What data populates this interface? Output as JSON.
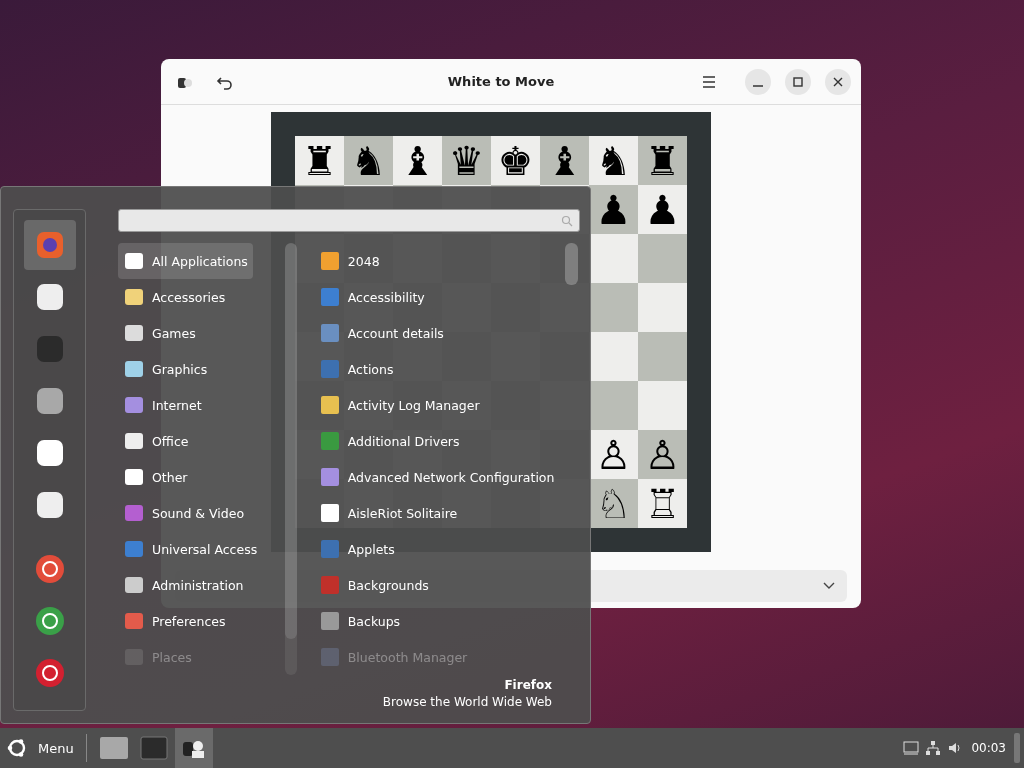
{
  "chess_window": {
    "title": "White to Move",
    "board": [
      [
        {
          "empty": false,
          "piece": "♜"
        },
        {
          "empty": false,
          "piece": "♞"
        },
        {
          "empty": false,
          "piece": "♝"
        },
        {
          "empty": false,
          "piece": "♛"
        },
        {
          "empty": false,
          "piece": "♚"
        },
        {
          "empty": false,
          "piece": "♝"
        },
        {
          "empty": false,
          "piece": "♞"
        },
        {
          "empty": false,
          "piece": "♜"
        }
      ],
      [
        {
          "empty": false,
          "piece": "♟"
        },
        {
          "empty": false,
          "piece": "♟"
        }
      ],
      [
        {
          "empty": true
        },
        {
          "empty": true
        }
      ],
      [
        {
          "empty": true
        },
        {
          "empty": true
        }
      ],
      [
        {
          "empty": true
        },
        {
          "empty": true
        }
      ],
      [
        {
          "empty": true
        },
        {
          "empty": true
        }
      ],
      [
        {
          "empty": false,
          "piece": "♙"
        },
        {
          "empty": false,
          "piece": "♙"
        }
      ],
      [
        {
          "empty": false,
          "piece": "♘"
        },
        {
          "empty": false,
          "piece": "♖"
        }
      ]
    ]
  },
  "menu": {
    "favorites": [
      {
        "selected": true
      },
      {
        "selected": false
      },
      {
        "selected": false
      },
      {
        "selected": false
      },
      {
        "selected": false
      },
      {
        "selected": false
      }
    ],
    "session": [
      {
        "selected": false
      },
      {
        "selected": false
      },
      {
        "selected": false
      }
    ],
    "categories": [
      {
        "label": "All Applications",
        "selected": true,
        "dimmed": false
      },
      {
        "label": "Accessories",
        "selected": false,
        "dimmed": false
      },
      {
        "label": "Games",
        "selected": false,
        "dimmed": false
      },
      {
        "label": "Graphics",
        "selected": false,
        "dimmed": false
      },
      {
        "label": "Internet",
        "selected": false,
        "dimmed": false
      },
      {
        "label": "Office",
        "selected": false,
        "dimmed": false
      },
      {
        "label": "Other",
        "selected": false,
        "dimmed": false
      },
      {
        "label": "Sound & Video",
        "selected": false,
        "dimmed": false
      },
      {
        "label": "Universal Access",
        "selected": false,
        "dimmed": false
      },
      {
        "label": "Administration",
        "selected": false,
        "dimmed": false
      },
      {
        "label": "Preferences",
        "selected": false,
        "dimmed": false
      },
      {
        "label": "Places",
        "selected": false,
        "dimmed": true
      }
    ],
    "apps": [
      {
        "label": "2048",
        "dimmed": false
      },
      {
        "label": "Accessibility",
        "dimmed": false
      },
      {
        "label": "Account details",
        "dimmed": false
      },
      {
        "label": "Actions",
        "dimmed": false
      },
      {
        "label": "Activity Log Manager",
        "dimmed": false
      },
      {
        "label": "Additional Drivers",
        "dimmed": false
      },
      {
        "label": "Advanced Network Configuration",
        "dimmed": false
      },
      {
        "label": "AisleRiot Solitaire",
        "dimmed": false
      },
      {
        "label": "Applets",
        "dimmed": false
      },
      {
        "label": "Backgrounds",
        "dimmed": false
      },
      {
        "label": "Backups",
        "dimmed": false
      },
      {
        "label": "Bluetooth Manager",
        "dimmed": true
      }
    ],
    "info": {
      "title": "Firefox",
      "description": "Browse the World Wide Web"
    }
  },
  "taskbar": {
    "menu_label": "Menu",
    "windows": [
      {
        "selected": false
      },
      {
        "selected": false
      },
      {
        "selected": true
      }
    ],
    "clock": "00:03"
  }
}
